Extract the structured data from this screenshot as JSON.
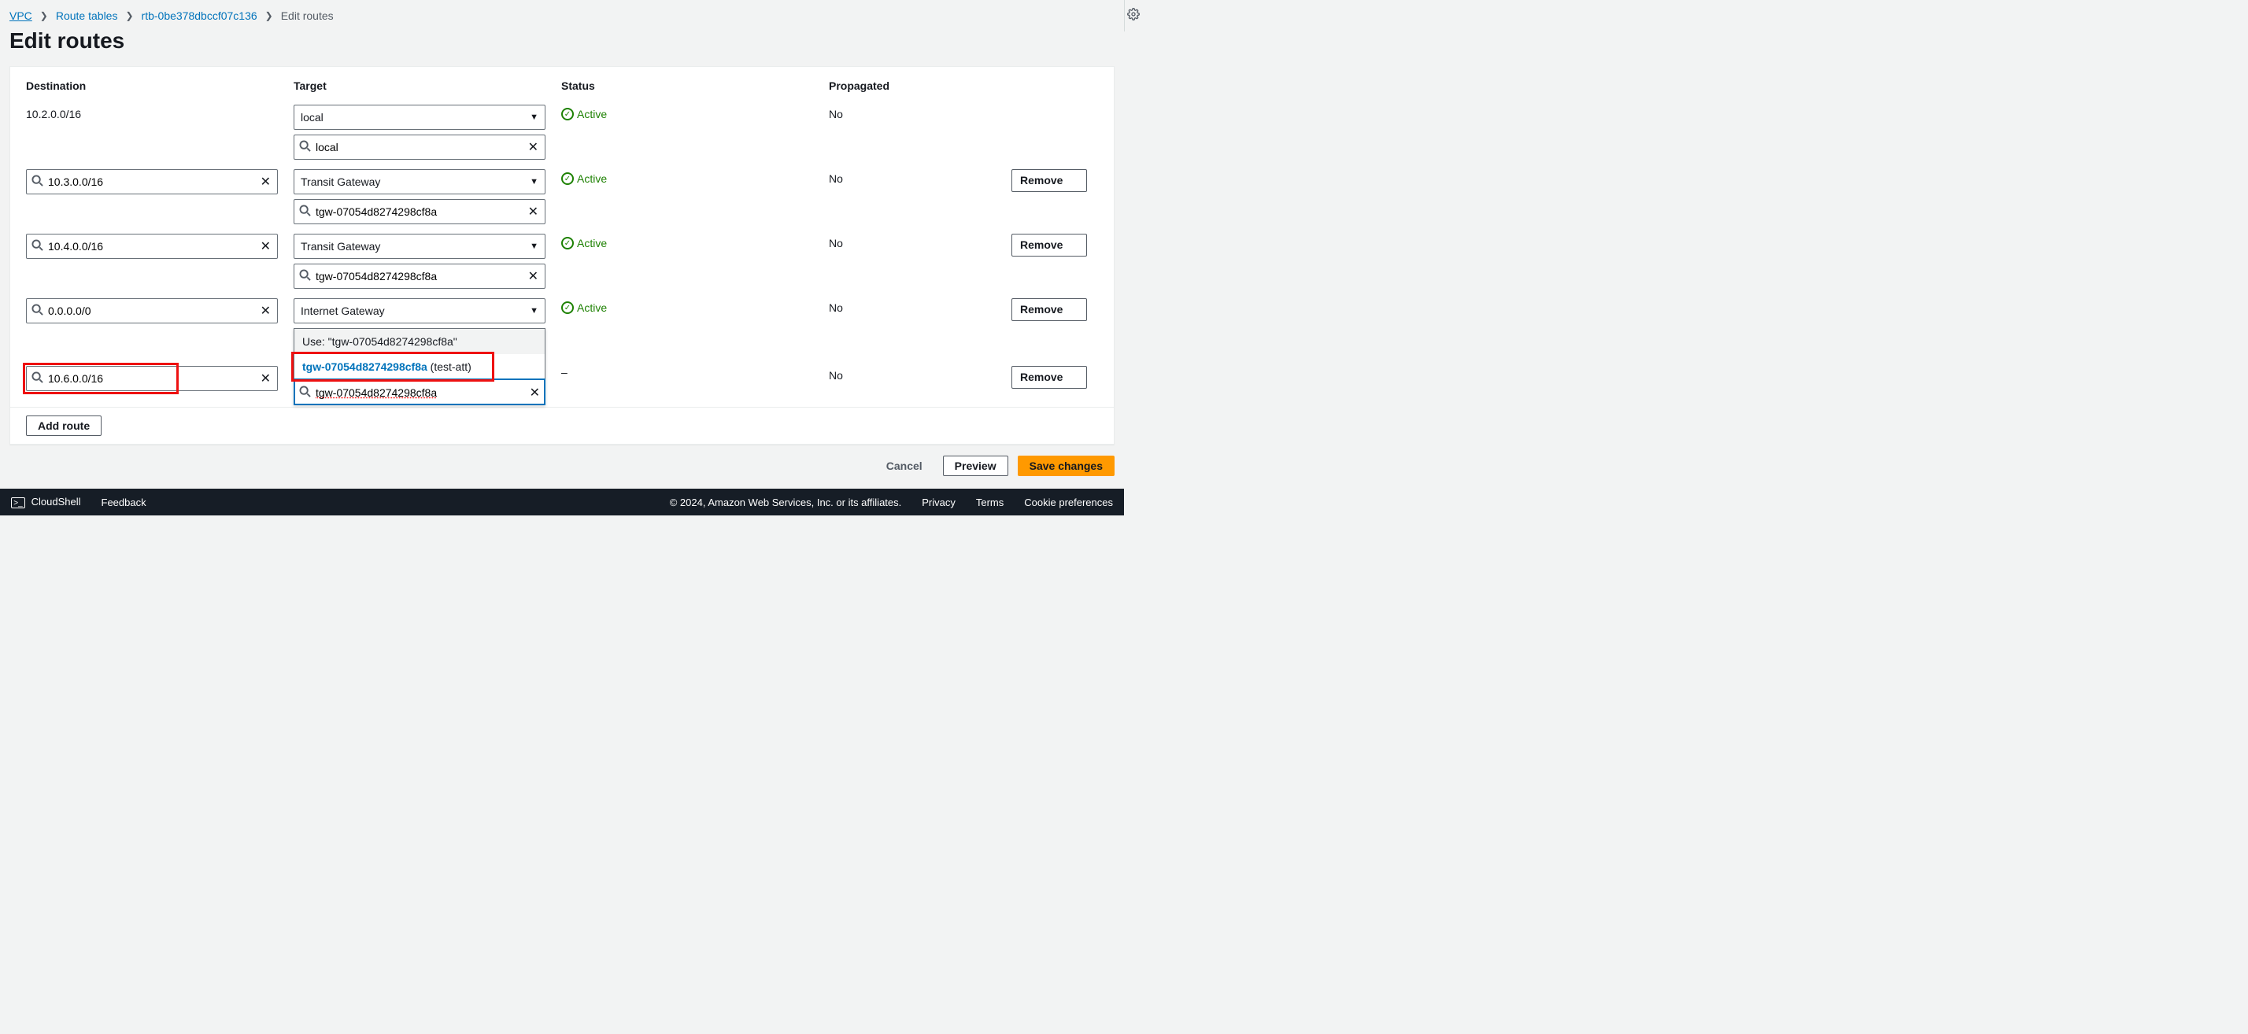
{
  "breadcrumbs": {
    "vpc": "VPC",
    "route_tables": "Route tables",
    "rtb_id": "rtb-0be378dbccf07c136",
    "current": "Edit routes"
  },
  "page_title": "Edit routes",
  "headers": {
    "destination": "Destination",
    "target": "Target",
    "status": "Status",
    "propagated": "Propagated"
  },
  "status_labels": {
    "active": "Active",
    "dash": "–"
  },
  "propagated_no": "No",
  "buttons": {
    "remove": "Remove",
    "add_route": "Add route",
    "cancel": "Cancel",
    "preview": "Preview",
    "save": "Save changes",
    "cloudshell": "CloudShell",
    "feedback": "Feedback"
  },
  "routes": {
    "r0": {
      "destination": "10.2.0.0/16",
      "target_select": "local",
      "target_search": "local"
    },
    "r1": {
      "destination": "10.3.0.0/16",
      "target_select": "Transit Gateway",
      "target_search": "tgw-07054d8274298cf8a"
    },
    "r2": {
      "destination": "10.4.0.0/16",
      "target_select": "Transit Gateway",
      "target_search": "tgw-07054d8274298cf8a"
    },
    "r3": {
      "destination": "0.0.0.0/0",
      "target_select": "Internet Gateway",
      "target_search": ""
    },
    "r4": {
      "destination": "10.6.0.0/16",
      "target_search": "tgw-07054d8274298cf8a",
      "dropdown": {
        "use_label": "Use: \"tgw-07054d8274298cf8a\"",
        "option_id": "tgw-07054d8274298cf8a",
        "option_name": " (test-att)"
      }
    }
  },
  "footer": {
    "copyright": "© 2024, Amazon Web Services, Inc. or its affiliates.",
    "privacy": "Privacy",
    "terms": "Terms",
    "cookies": "Cookie preferences"
  }
}
